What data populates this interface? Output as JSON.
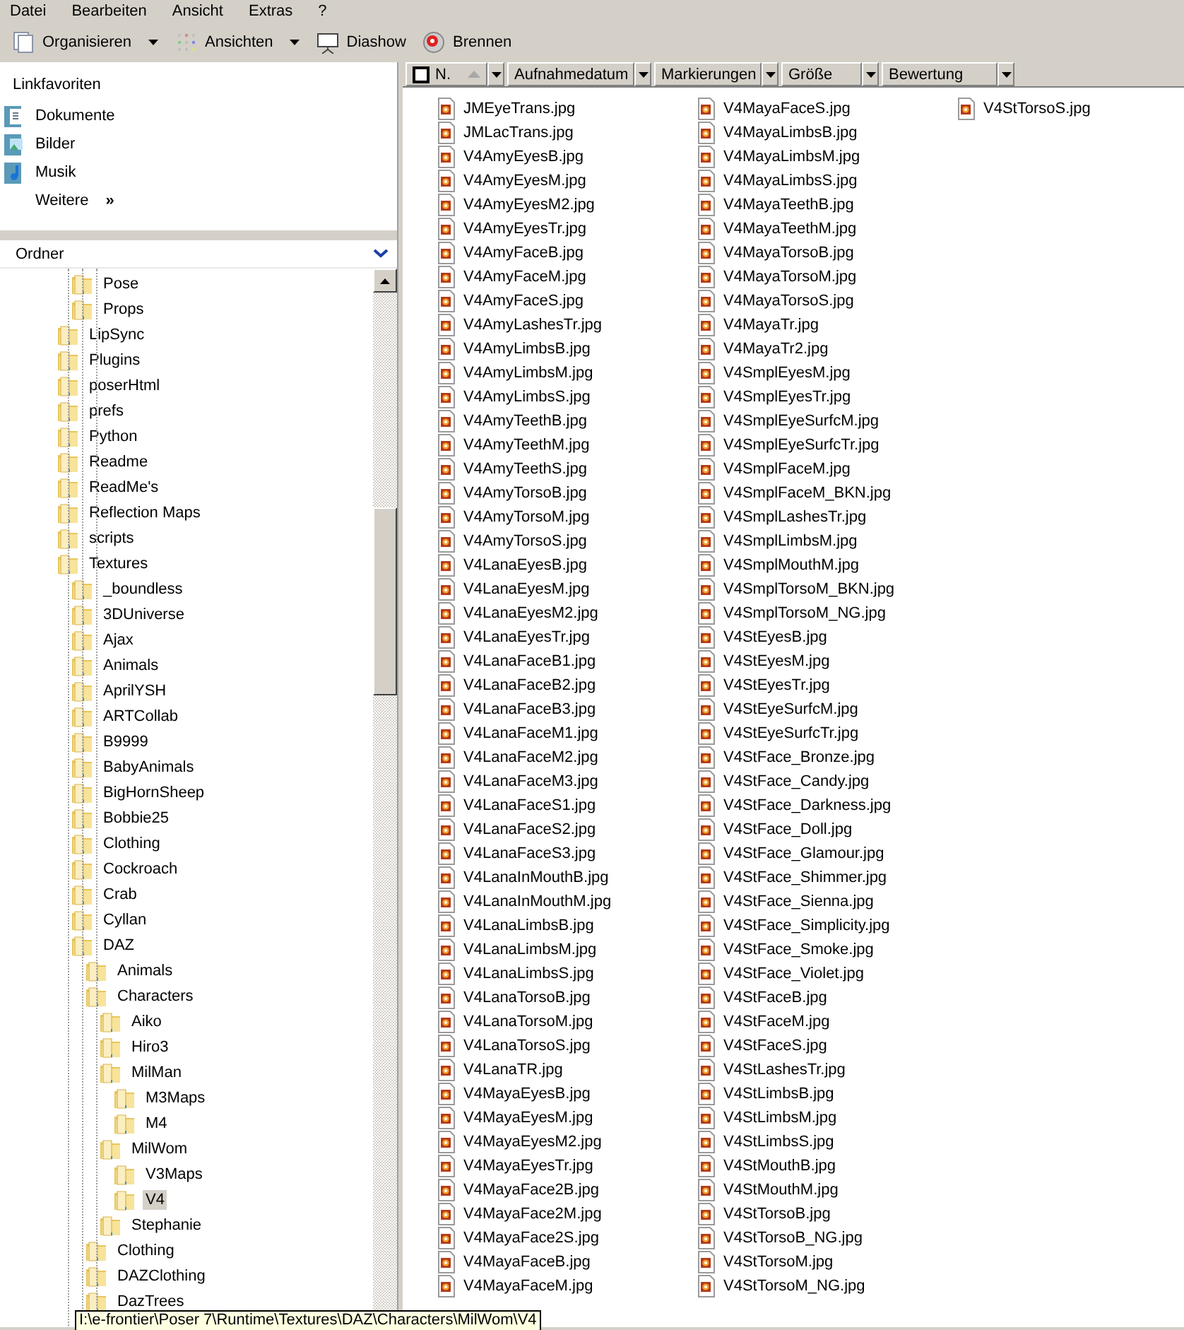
{
  "menu": [
    "Datei",
    "Bearbeiten",
    "Ansicht",
    "Extras",
    "?"
  ],
  "toolbar": [
    {
      "label": "Organisieren",
      "kind": "organize",
      "dropdown": true
    },
    {
      "label": "Ansichten",
      "kind": "views",
      "dropdown": true
    },
    {
      "label": "Diashow",
      "kind": "slideshow",
      "dropdown": false
    },
    {
      "label": "Brennen",
      "kind": "burn",
      "dropdown": false
    }
  ],
  "favorites": {
    "title": "Linkfavoriten",
    "items": [
      {
        "label": "Dokumente",
        "kind": "documents"
      },
      {
        "label": "Bilder",
        "kind": "pictures"
      },
      {
        "label": "Musik",
        "kind": "music"
      }
    ],
    "more": {
      "label": "Weitere",
      "glyph": "»"
    }
  },
  "folders": {
    "title": "Ordner",
    "items_of_parent_above": [
      {
        "label": "Pose",
        "selected": false
      },
      {
        "label": "Props",
        "selected": false
      }
    ],
    "items": [
      {
        "label": "LipSync",
        "selected": false
      },
      {
        "label": "Plugins",
        "selected": false
      },
      {
        "label": "poserHtml",
        "selected": false
      },
      {
        "label": "prefs",
        "selected": false
      },
      {
        "label": "Python",
        "selected": false
      },
      {
        "label": "Readme",
        "selected": false
      },
      {
        "label": "ReadMe's",
        "selected": false
      },
      {
        "label": "Reflection Maps",
        "selected": false
      },
      {
        "label": "scripts",
        "selected": false
      },
      {
        "label": "Textures",
        "selected": false,
        "children": [
          {
            "label": "_boundless",
            "selected": false
          },
          {
            "label": "3DUniverse",
            "selected": false
          },
          {
            "label": "Ajax",
            "selected": false
          },
          {
            "label": "Animals",
            "selected": false
          },
          {
            "label": "AprilYSH",
            "selected": false
          },
          {
            "label": "ARTCollab",
            "selected": false
          },
          {
            "label": "B9999",
            "selected": false
          },
          {
            "label": "BabyAnimals",
            "selected": false
          },
          {
            "label": "BigHornSheep",
            "selected": false
          },
          {
            "label": "Bobbie25",
            "selected": false
          },
          {
            "label": "Clothing",
            "selected": false
          },
          {
            "label": "Cockroach",
            "selected": false
          },
          {
            "label": "Crab",
            "selected": false
          },
          {
            "label": "Cyllan",
            "selected": false
          },
          {
            "label": "DAZ",
            "selected": false,
            "children": [
              {
                "label": "Animals",
                "selected": false
              },
              {
                "label": "Characters",
                "selected": false,
                "children": [
                  {
                    "label": "Aiko",
                    "selected": false
                  },
                  {
                    "label": "Hiro3",
                    "selected": false
                  },
                  {
                    "label": "MilMan",
                    "selected": false,
                    "children": [
                      {
                        "label": "M3Maps",
                        "selected": false
                      },
                      {
                        "label": "M4",
                        "selected": false
                      }
                    ]
                  },
                  {
                    "label": "MilWom",
                    "selected": false,
                    "children": [
                      {
                        "label": "V3Maps",
                        "selected": false
                      },
                      {
                        "label": "V4",
                        "selected": true
                      }
                    ]
                  },
                  {
                    "label": "Stephanie",
                    "selected": false
                  }
                ]
              },
              {
                "label": "Clothing",
                "selected": false
              },
              {
                "label": "DAZClothing",
                "selected": false
              },
              {
                "label": "DazTrees",
                "selected": false
              }
            ]
          }
        ]
      }
    ]
  },
  "columns": [
    {
      "label": "N.",
      "sorted": true
    },
    {
      "label": "Aufnahmedatum",
      "sorted": false
    },
    {
      "label": "Markierungen",
      "sorted": false
    },
    {
      "label": "Größe",
      "sorted": false
    },
    {
      "label": "Bewertung",
      "sorted": false
    }
  ],
  "select_all": {
    "checked": false
  },
  "files": [
    "JMEyeTrans.jpg",
    "JMLacTrans.jpg",
    "V4AmyEyesB.jpg",
    "V4AmyEyesM.jpg",
    "V4AmyEyesM2.jpg",
    "V4AmyEyesTr.jpg",
    "V4AmyFaceB.jpg",
    "V4AmyFaceM.jpg",
    "V4AmyFaceS.jpg",
    "V4AmyLashesTr.jpg",
    "V4AmyLimbsB.jpg",
    "V4AmyLimbsM.jpg",
    "V4AmyLimbsS.jpg",
    "V4AmyTeethB.jpg",
    "V4AmyTeethM.jpg",
    "V4AmyTeethS.jpg",
    "V4AmyTorsoB.jpg",
    "V4AmyTorsoM.jpg",
    "V4AmyTorsoS.jpg",
    "V4LanaEyesB.jpg",
    "V4LanaEyesM.jpg",
    "V4LanaEyesM2.jpg",
    "V4LanaEyesTr.jpg",
    "V4LanaFaceB1.jpg",
    "V4LanaFaceB2.jpg",
    "V4LanaFaceB3.jpg",
    "V4LanaFaceM1.jpg",
    "V4LanaFaceM2.jpg",
    "V4LanaFaceM3.jpg",
    "V4LanaFaceS1.jpg",
    "V4LanaFaceS2.jpg",
    "V4LanaFaceS3.jpg",
    "V4LanaInMouthB.jpg",
    "V4LanaInMouthM.jpg",
    "V4LanaLimbsB.jpg",
    "V4LanaLimbsM.jpg",
    "V4LanaLimbsS.jpg",
    "V4LanaTorsoB.jpg",
    "V4LanaTorsoM.jpg",
    "V4LanaTorsoS.jpg",
    "V4LanaTR.jpg",
    "V4MayaEyesB.jpg",
    "V4MayaEyesM.jpg",
    "V4MayaEyesM2.jpg",
    "V4MayaEyesTr.jpg",
    "V4MayaFace2B.jpg",
    "V4MayaFace2M.jpg",
    "V4MayaFace2S.jpg",
    "V4MayaFaceB.jpg",
    "V4MayaFaceM.jpg",
    "V4MayaFaceS.jpg",
    "V4MayaLimbsB.jpg",
    "V4MayaLimbsM.jpg",
    "V4MayaLimbsS.jpg",
    "V4MayaTeethB.jpg",
    "V4MayaTeethM.jpg",
    "V4MayaTorsoB.jpg",
    "V4MayaTorsoM.jpg",
    "V4MayaTorsoS.jpg",
    "V4MayaTr.jpg",
    "V4MayaTr2.jpg",
    "V4SmplEyesM.jpg",
    "V4SmplEyesTr.jpg",
    "V4SmplEyeSurfcM.jpg",
    "V4SmplEyeSurfcTr.jpg",
    "V4SmplFaceM.jpg",
    "V4SmplFaceM_BKN.jpg",
    "V4SmplLashesTr.jpg",
    "V4SmplLimbsM.jpg",
    "V4SmplMouthM.jpg",
    "V4SmplTorsoM_BKN.jpg",
    "V4SmplTorsoM_NG.jpg",
    "V4StEyesB.jpg",
    "V4StEyesM.jpg",
    "V4StEyesTr.jpg",
    "V4StEyeSurfcM.jpg",
    "V4StEyeSurfcTr.jpg",
    "V4StFace_Bronze.jpg",
    "V4StFace_Candy.jpg",
    "V4StFace_Darkness.jpg",
    "V4StFace_Doll.jpg",
    "V4StFace_Glamour.jpg",
    "V4StFace_Shimmer.jpg",
    "V4StFace_Sienna.jpg",
    "V4StFace_Simplicity.jpg",
    "V4StFace_Smoke.jpg",
    "V4StFace_Violet.jpg",
    "V4StFaceB.jpg",
    "V4StFaceM.jpg",
    "V4StFaceS.jpg",
    "V4StLashesTr.jpg",
    "V4StLimbsB.jpg",
    "V4StLimbsM.jpg",
    "V4StLimbsS.jpg",
    "V4StMouthB.jpg",
    "V4StMouthM.jpg",
    "V4StTorsoB.jpg",
    "V4StTorsoB_NG.jpg",
    "V4StTorsoM.jpg",
    "V4StTorsoM_NG.jpg",
    "V4StTorsoS.jpg"
  ],
  "tooltip": "I:\\e-frontier\\Poser 7\\Runtime\\Textures\\DAZ\\Characters\\MilWom\\V4"
}
